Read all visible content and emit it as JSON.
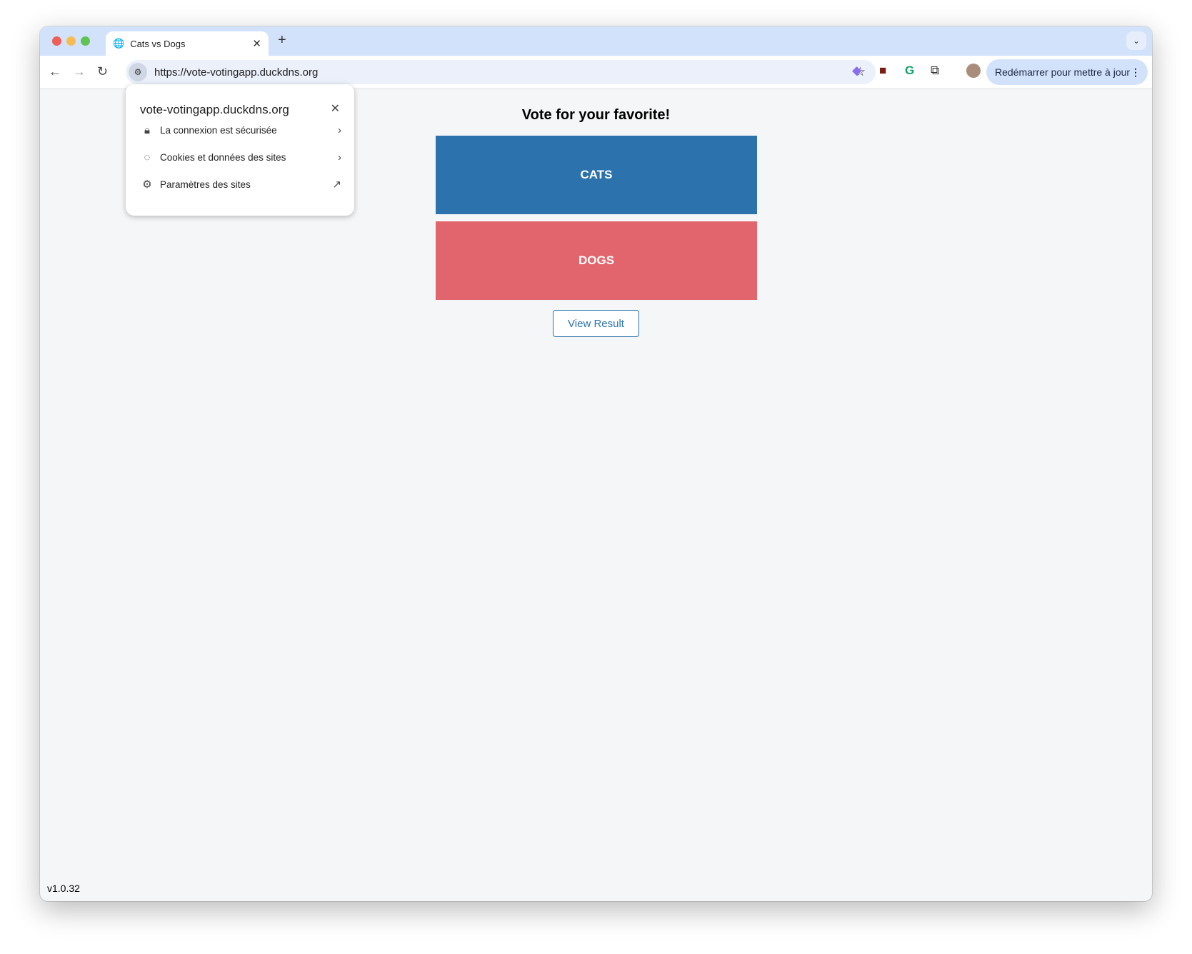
{
  "browser": {
    "tab_title": "Cats vs Dogs",
    "url": "https://vote-votingapp.duckdns.org",
    "restart_label": "Redémarrer pour mettre à jour"
  },
  "site_popup": {
    "domain": "vote-votingapp.duckdns.org",
    "items": [
      {
        "label": "La connexion est sécurisée",
        "icon": "lock-icon"
      },
      {
        "label": "Cookies et données des sites",
        "icon": "cookie-icon"
      },
      {
        "label": "Paramètres des sites",
        "icon": "gear-icon"
      }
    ]
  },
  "page": {
    "title": "Vote for your favorite!",
    "option_a": "CATS",
    "option_b": "DOGS",
    "view_result": "View Result",
    "version": "v1.0.32"
  },
  "colors": {
    "cats": "#2c73ad",
    "dogs": "#e2646c",
    "background": "#f5f6f8"
  }
}
